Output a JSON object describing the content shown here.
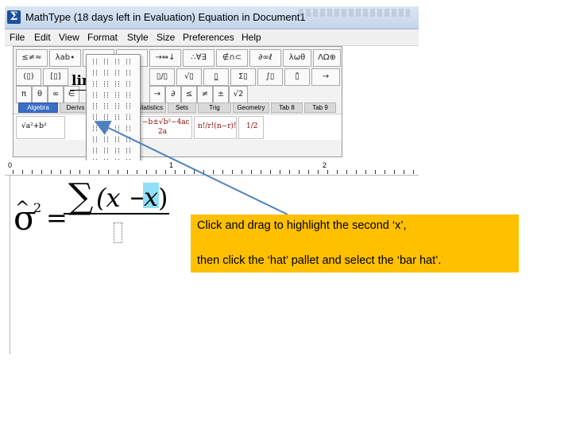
{
  "window": {
    "title": "MathType (18 days left in Evaluation)   Equation in Document1",
    "icon": "sigma-app-icon"
  },
  "menu": [
    "File",
    "Edit",
    "View",
    "Format",
    "Style",
    "Size",
    "Preferences",
    "Help"
  ],
  "toolbar": {
    "symbol_row": [
      "≤≠≈",
      "λab∙",
      "⁎⁏∴",
      "±•⊗",
      "→⇔↓",
      "∴∀∃",
      "∉∩⊂",
      "∂∞ℓ",
      "λωθ",
      "ΛΩ⊕"
    ],
    "template_row": [
      "(▯)",
      "[▯]",
      "▯/▯",
      "√▯",
      "▯̲",
      "Σ▯",
      "∫▯",
      "▯̄",
      "→",
      "Ů",
      "▯▯",
      "▯⁞"
    ],
    "tabs": [
      "Algebra",
      "Derivs",
      "Statistics",
      "Sets",
      "Trig",
      "Geometry",
      "Tab 8",
      "Tab 9"
    ],
    "active_tab": "Algebra",
    "template_previews": [
      "√a²+b²",
      "lim",
      "n!/r!(n−r)!",
      "1/2"
    ],
    "small_row": [
      "π",
      "θ",
      "∞",
      "∈",
      "→",
      "∂",
      "≤",
      "≠",
      "±",
      "√2"
    ]
  },
  "ruler": {
    "marks": [
      "0",
      "1",
      "2"
    ]
  },
  "equation": {
    "lhs": "σ",
    "exponent": "2",
    "equals": "=",
    "sum": "∑",
    "open": "(x −",
    "selected": "x",
    "close": ")"
  },
  "callout": {
    "line1": "Click and drag to highlight the second ‘x’,",
    "line2": "then click the ‘hat’ pallet and select the ‘bar hat’.",
    "background": "#ffc000"
  },
  "colors": {
    "highlight": "#8fe0f7",
    "arrow": "#4f81bd",
    "active_tab": "#3a6fc8"
  }
}
